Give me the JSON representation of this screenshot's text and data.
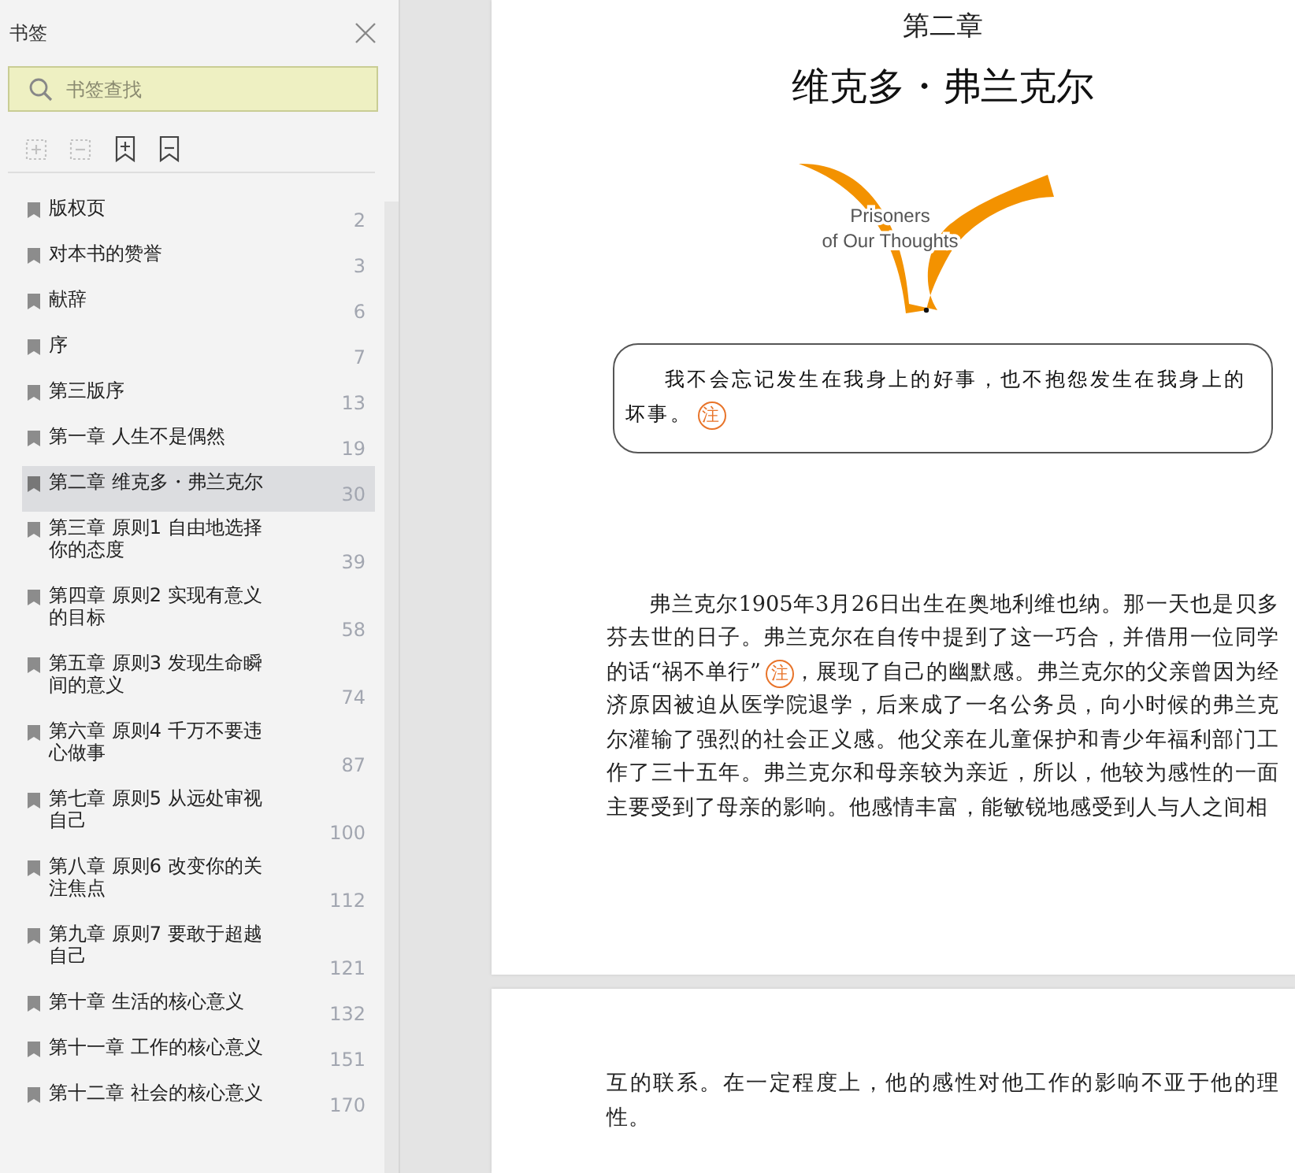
{
  "sidebar": {
    "title": "书签",
    "search": {
      "placeholder": "书签查找"
    },
    "toolbar": [
      {
        "kind": "expand",
        "disabled": true
      },
      {
        "kind": "collapse",
        "disabled": true
      },
      {
        "kind": "add",
        "disabled": false
      },
      {
        "kind": "bookmark",
        "disabled": false
      }
    ],
    "items": [
      {
        "title": "版权页",
        "page": "2",
        "selected": false
      },
      {
        "title": "对本书的赞誉",
        "page": "3",
        "selected": false
      },
      {
        "title": "献辞",
        "page": "6",
        "selected": false
      },
      {
        "title": "序",
        "page": "7",
        "selected": false
      },
      {
        "title": "第三版序",
        "page": "13",
        "selected": false
      },
      {
        "title": "第一章  人生不是偶然",
        "page": "19",
        "selected": false
      },
      {
        "title": "第二章  维克多・弗兰克尔",
        "page": "30",
        "selected": true
      },
      {
        "title": "第三章  原则1  自由地选择你的态度",
        "page": "39",
        "selected": false
      },
      {
        "title": "第四章  原则2  实现有意义的目标",
        "page": "58",
        "selected": false
      },
      {
        "title": "第五章  原则3  发现生命瞬间的意义",
        "page": "74",
        "selected": false
      },
      {
        "title": "第六章  原则4  千万不要违心做事",
        "page": "87",
        "selected": false
      },
      {
        "title": "第七章  原则5  从远处审视自己",
        "page": "100",
        "selected": false
      },
      {
        "title": "第八章  原则6  改变你的关注焦点",
        "page": "112",
        "selected": false
      },
      {
        "title": "第九章  原则7  要敢于超越自己",
        "page": "121",
        "selected": false
      },
      {
        "title": "第十章  生活的核心意义",
        "page": "132",
        "selected": false
      },
      {
        "title": "第十一章  工作的核心意义",
        "page": "151",
        "selected": false
      },
      {
        "title": "第十二章  社会的核心意义",
        "page": "170",
        "selected": false
      }
    ]
  },
  "pages": [
    {
      "chapter": "第二章",
      "title": "维克多・弗兰克尔",
      "logo": [
        "Prisoners",
        "of Our Thoughts"
      ],
      "quote": {
        "text": "我不会忘记发生在我身上的好事，也不抱怨发生在我身上的坏事。",
        "note": "注"
      },
      "paragraph": {
        "before": "弗兰克尔1905年3月26日出生在奥地利维也纳。那一天也是贝多芬去世的日子。弗兰克尔在自传中提到了这一巧合，并借用一位同学的话“祸不单行”",
        "note": "注",
        "after": "，展现了自己的幽默感。弗兰克尔的父亲曾因为经济原因被迫从医学院退学，后来成了一名公务员，向小时候的弗兰克尔灌输了强烈的社会正义感。他父亲在儿童保护和青少年福利部门工作了三十五年。弗兰克尔和母亲较为亲近，所以，他较为感性的一面主要受到了母亲的影响。他感情丰富，能敏锐地感受到人与人之间相"
      }
    },
    {
      "paragraph": {
        "before": "互的联系。在一定程度上，他的感性对他工作的影响不亚于他的理性。"
      }
    }
  ]
}
